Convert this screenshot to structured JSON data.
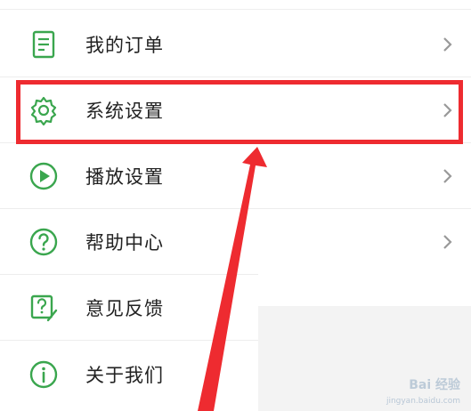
{
  "menu": {
    "items": [
      {
        "label": "我的订单",
        "icon": "document-icon",
        "chevron": "chevron-right-icon"
      },
      {
        "label": "系统设置",
        "icon": "gear-icon",
        "chevron": "chevron-right-icon"
      },
      {
        "label": "播放设置",
        "icon": "play-icon",
        "chevron": "chevron-right-icon"
      },
      {
        "label": "帮助中心",
        "icon": "question-icon",
        "chevron": "chevron-right-icon"
      },
      {
        "label": "意见反馈",
        "icon": "feedback-icon"
      },
      {
        "label": "关于我们",
        "icon": "info-icon"
      }
    ]
  },
  "watermark": {
    "text": "Bai 经验",
    "url": "jingyan.baidu.com"
  },
  "colors": {
    "icon_green": "#3aa64e",
    "highlight_red": "#ee2b30",
    "chevron_gray": "#999999"
  }
}
